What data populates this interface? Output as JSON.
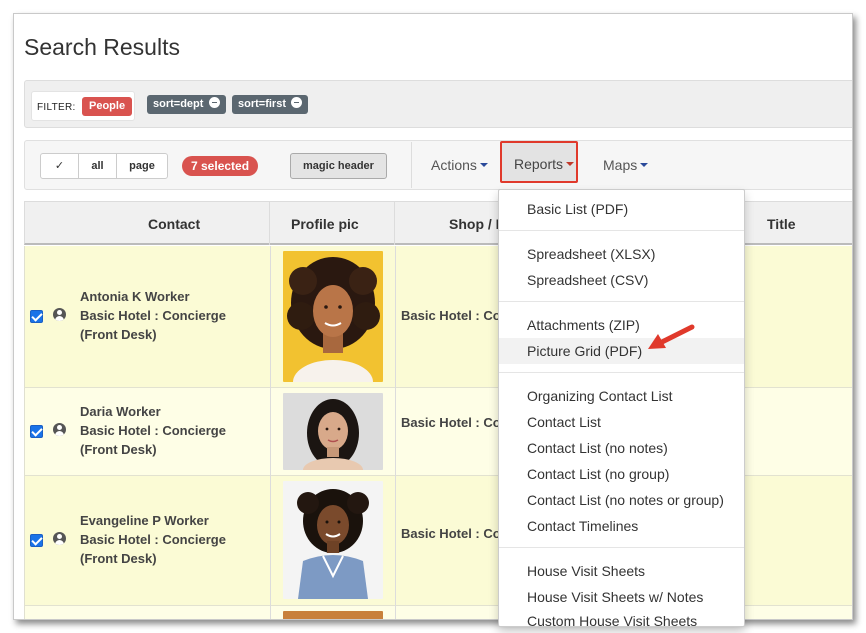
{
  "page": {
    "title": "Search Results"
  },
  "filter": {
    "label": "FILTER:",
    "people_badge": "People",
    "sorts": [
      "sort=dept",
      "sort=first"
    ]
  },
  "toolbar": {
    "check_label": "✓",
    "all_label": "all",
    "page_label": "page",
    "selected_badge": "7 selected",
    "magic_header": "magic header",
    "actions": "Actions",
    "reports": "Reports",
    "maps": "Maps"
  },
  "table": {
    "headers": {
      "contact": "Contact",
      "profile_pic": "Profile pic",
      "shop": "Shop / D",
      "title": "Title"
    },
    "rows": [
      {
        "name": "Antonia K Worker",
        "role": "Basic Hotel : Concierge",
        "dept": "(Front Desk)",
        "shop": "Basic Hotel : Co"
      },
      {
        "name": "Daria Worker",
        "role": "Basic Hotel : Concierge",
        "dept": "(Front Desk)",
        "shop": "Basic Hotel : Co"
      },
      {
        "name": "Evangeline P Worker",
        "role": "Basic Hotel : Concierge",
        "dept": "(Front Desk)",
        "shop": "Basic Hotel : Co"
      }
    ]
  },
  "reports_menu": {
    "groups": [
      [
        "Basic List (PDF)"
      ],
      [
        "Spreadsheet (XLSX)",
        "Spreadsheet (CSV)"
      ],
      [
        "Attachments (ZIP)",
        "Picture Grid (PDF)"
      ],
      [
        "Organizing Contact List",
        "Contact List",
        "Contact List (no notes)",
        "Contact List (no group)",
        "Contact List (no notes or group)",
        "Contact Timelines"
      ],
      [
        "House Visit Sheets",
        "House Visit Sheets w/ Notes",
        "Custom House Visit Sheets"
      ]
    ],
    "highlighted": "Picture Grid (PDF)"
  },
  "colors": {
    "danger": "#d9534f",
    "pill": "#5b6770",
    "row_highlight": "#fbfbd5",
    "annotation_red": "#e0392b"
  }
}
